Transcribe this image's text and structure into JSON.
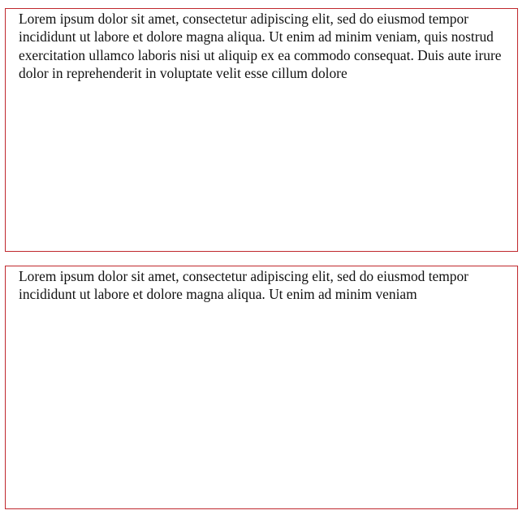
{
  "boxes": [
    {
      "text": "Lorem ipsum dolor sit amet, consectetur adipiscing elit, sed do eiusmod tempor incididunt ut labore et dolore magna aliqua. Ut enim ad minim veniam, quis nostrud exercitation ullamco laboris nisi ut aliquip ex ea commodo consequat. Duis aute irure dolor in reprehenderit in voluptate velit esse cillum dolore"
    },
    {
      "text": "Lorem ipsum dolor sit amet, consectetur adipiscing elit, sed do eiusmod tempor incididunt ut labore et dolore magna aliqua. Ut enim ad minim veniam"
    }
  ],
  "colors": {
    "border": "#c0282d",
    "text": "#111111",
    "background": "#ffffff"
  }
}
